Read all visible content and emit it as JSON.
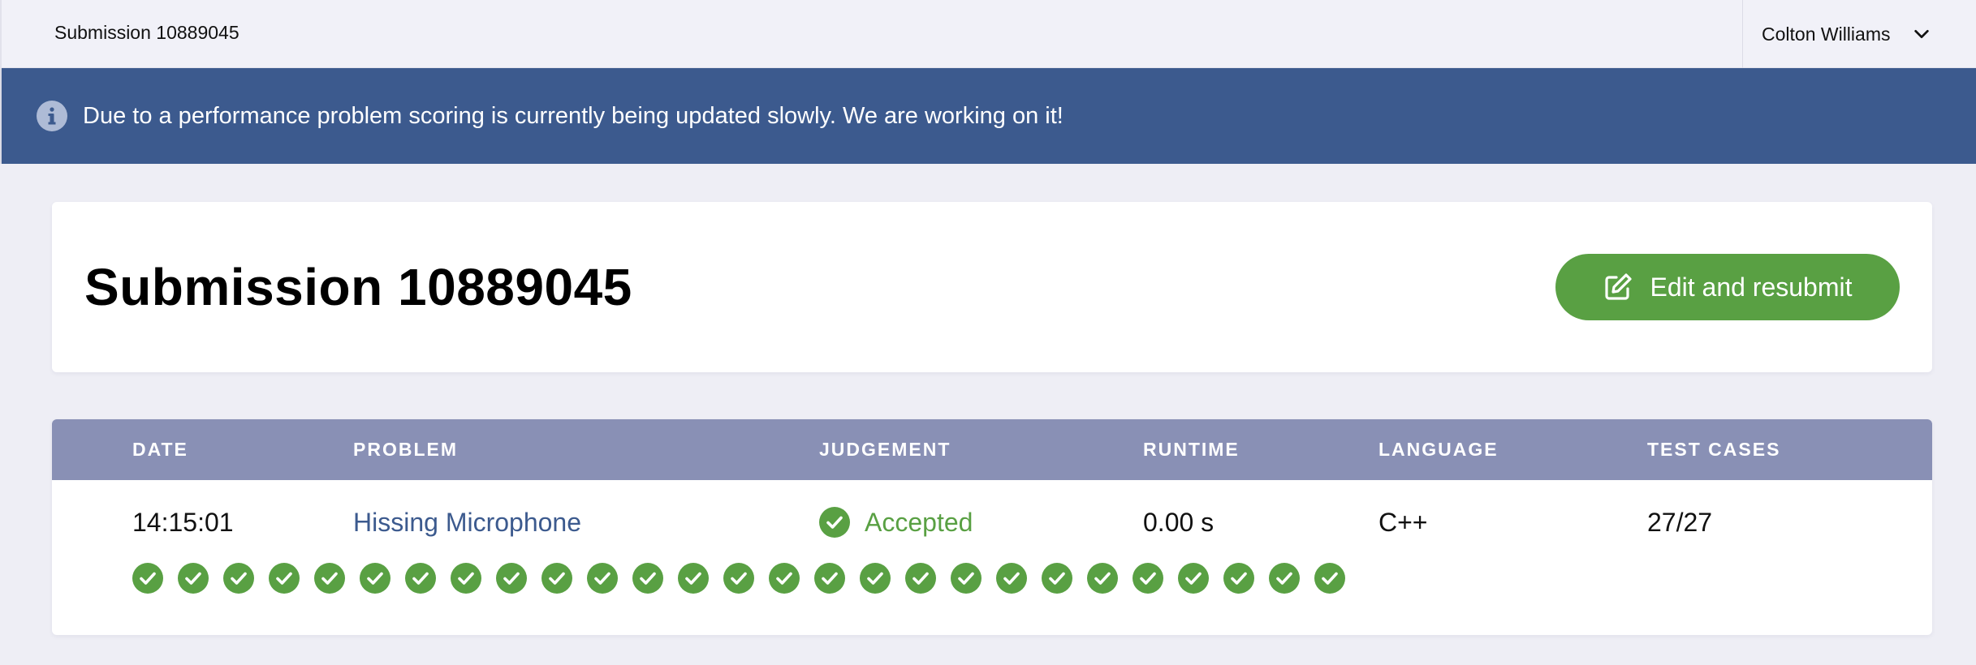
{
  "topbar": {
    "title": "Submission 10889045",
    "user_name": "Colton Williams"
  },
  "banner": {
    "icon": "info-icon",
    "text": "Due to a performance problem scoring is currently being updated slowly. We are working on it!"
  },
  "header": {
    "title": "Submission 10889045",
    "resubmit_label": "Edit and resubmit",
    "resubmit_icon": "edit-icon"
  },
  "table": {
    "headers": {
      "date": "DATE",
      "problem": "PROBLEM",
      "judgement": "JUDGEMENT",
      "runtime": "RUNTIME",
      "language": "LANGUAGE",
      "test_cases": "TEST CASES"
    },
    "row": {
      "date": "14:15:01",
      "problem": "Hissing Microphone",
      "judgement": "Accepted",
      "runtime": "0.00 s",
      "language": "C++",
      "test_cases": "27/27"
    },
    "test_results": [
      "accepted",
      "accepted",
      "accepted",
      "accepted",
      "accepted",
      "accepted",
      "accepted",
      "accepted",
      "accepted",
      "accepted",
      "accepted",
      "accepted",
      "accepted",
      "accepted",
      "accepted",
      "accepted",
      "accepted",
      "accepted",
      "accepted",
      "accepted",
      "accepted",
      "accepted",
      "accepted",
      "accepted",
      "accepted",
      "accepted",
      "accepted"
    ]
  },
  "colors": {
    "banner": "#3c5a8e",
    "accent_green": "#59a043",
    "table_header": "#8990b5",
    "link": "#3c5a8e"
  }
}
